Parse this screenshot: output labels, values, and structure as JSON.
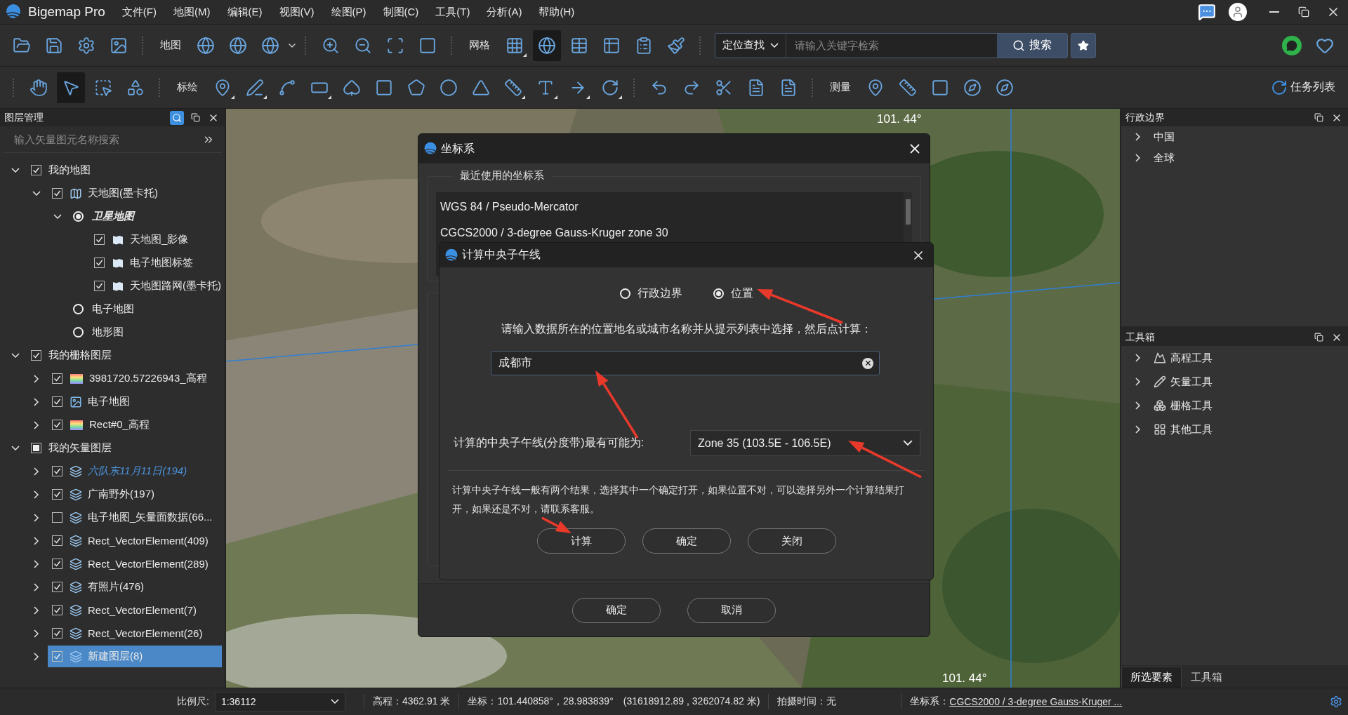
{
  "window": {
    "title": "Bigemap Pro"
  },
  "menu": [
    "文件(F)",
    "地图(M)",
    "编辑(E)",
    "视图(V)",
    "绘图(P)",
    "制图(C)",
    "工具(T)",
    "分析(A)",
    "帮助(H)"
  ],
  "toolbar_1": {
    "sections": [
      {
        "tools": [
          {
            "selected": false
          },
          {
            "selected": false
          },
          {
            "selected": false
          },
          {
            "selected": false
          }
        ]
      },
      {
        "label": "地图",
        "tools": [
          {
            "selected": false
          },
          {
            "selected": false
          },
          {
            "selected": false
          }
        ]
      },
      {
        "tools": [
          {
            "selected": false
          },
          {
            "selected": false
          },
          {
            "selected": false
          },
          {
            "selected": false
          }
        ]
      },
      {
        "label": "网格",
        "tools": [
          {
            "selected": false
          },
          {
            "selected": true
          },
          {
            "selected": false
          },
          {
            "selected": false
          },
          {
            "selected": false
          },
          {
            "selected": false
          }
        ]
      }
    ],
    "search": {
      "mode": "定位查找",
      "placeholder": "请输入关键字检索",
      "button": "搜索"
    }
  },
  "toolbar_2": {
    "sections": [
      {
        "tools": [
          {
            "selected": false
          },
          {
            "selected": true
          },
          {
            "selected": false
          },
          {
            "selected": false
          }
        ]
      },
      {
        "label": "标绘",
        "tools": [
          {
            "selected": false
          },
          {
            "selected": false
          },
          {
            "selected": false
          },
          {
            "selected": false
          },
          {
            "selected": false
          },
          {
            "selected": false
          },
          {
            "selected": false
          },
          {
            "selected": false
          },
          {
            "selected": false
          },
          {
            "selected": false
          },
          {
            "selected": false
          },
          {
            "selected": false
          },
          {
            "selected": false
          }
        ]
      },
      {
        "tools": [
          {
            "selected": false
          },
          {
            "selected": false
          },
          {
            "selected": false
          },
          {
            "selected": false
          },
          {
            "selected": false
          }
        ]
      },
      {
        "label": "测量",
        "tools": [
          {
            "selected": false
          },
          {
            "selected": false
          },
          {
            "selected": false
          },
          {
            "selected": false
          },
          {
            "selected": false
          }
        ]
      }
    ],
    "task_list": "任务列表"
  },
  "layer_panel": {
    "title": "图层管理",
    "search_placeholder": "输入矢量图元名称搜索",
    "tree": [
      {
        "kind": "checkbox",
        "label": "我的地图",
        "checked": true,
        "expanded": true,
        "selected": false,
        "children": [
          {
            "kind": "checkbox",
            "label": "天地图(墨卡托)",
            "checked": true,
            "expanded": true,
            "selected": false,
            "children": [
              {
                "kind": "radio",
                "label": "卫星地图",
                "checked": true,
                "expanded": true,
                "selected": false,
                "children": [
                  {
                    "kind": "checkbox",
                    "label": "天地图_影像",
                    "checked": true,
                    "selected": false
                  },
                  {
                    "kind": "checkbox",
                    "label": "电子地图标签",
                    "checked": true,
                    "selected": false
                  },
                  {
                    "kind": "checkbox",
                    "label": "天地图路网(墨卡托)",
                    "checked": true,
                    "selected": false
                  }
                ]
              },
              {
                "kind": "radio",
                "label": "电子地图",
                "checked": false,
                "selected": false
              },
              {
                "kind": "radio",
                "label": "地形图",
                "checked": false,
                "selected": false
              }
            ]
          }
        ]
      },
      {
        "kind": "checkbox",
        "label": "我的栅格图层",
        "checked": true,
        "expanded": true,
        "selected": false,
        "children": [
          {
            "kind": "checkbox",
            "label": "3981720.57226943_高程",
            "checked": true,
            "expanded": false,
            "selected": false
          },
          {
            "kind": "checkbox",
            "label": "电子地图",
            "checked": true,
            "expanded": false,
            "selected": false
          },
          {
            "kind": "checkbox",
            "label": "Rect#0_高程",
            "checked": true,
            "expanded": false,
            "selected": false
          }
        ]
      },
      {
        "kind": "checkbox",
        "label": "我的矢量图层",
        "checked": false,
        "indeterminate": true,
        "expanded": true,
        "selected": false,
        "children": [
          {
            "kind": "checkbox",
            "label": "六队东11月11日(194)",
            "checked": true,
            "expanded": false,
            "selected": false,
            "active": true
          },
          {
            "kind": "checkbox",
            "label": "广南野外(197)",
            "checked": true,
            "expanded": false,
            "selected": false,
            "active": false
          },
          {
            "kind": "checkbox",
            "label": "电子地图_矢量面数据(66...",
            "checked": false,
            "expanded": false,
            "selected": false,
            "active": false
          },
          {
            "kind": "checkbox",
            "label": "Rect_VectorElement(409)",
            "checked": true,
            "expanded": false,
            "selected": false,
            "active": false
          },
          {
            "kind": "checkbox",
            "label": "Rect_VectorElement(289)",
            "checked": true,
            "expanded": false,
            "selected": false,
            "active": false
          },
          {
            "kind": "checkbox",
            "label": "有照片(476)",
            "checked": true,
            "expanded": false,
            "selected": false,
            "active": false
          },
          {
            "kind": "checkbox",
            "label": "Rect_VectorElement(7)",
            "checked": true,
            "expanded": false,
            "selected": false,
            "active": false
          },
          {
            "kind": "checkbox",
            "label": "Rect_VectorElement(26)",
            "checked": true,
            "expanded": false,
            "selected": false,
            "active": false
          },
          {
            "kind": "checkbox",
            "label": "新建图层(8)",
            "checked": true,
            "expanded": false,
            "selected": true,
            "active": false
          }
        ]
      }
    ]
  },
  "map": {
    "labels": [
      "101. 44°",
      "101. 44°"
    ]
  },
  "coord_dialog": {
    "title": "坐标系",
    "group": "最近使用的坐标系",
    "recent": [
      "WGS 84 / Pseudo-Mercator",
      "CGCS2000 / 3-degree Gauss-Kruger zone 30"
    ],
    "buttons": [
      "确定",
      "取消"
    ]
  },
  "meridian_dialog": {
    "title": "计算中央子午线",
    "options": [
      {
        "label": "行政边界",
        "selected": false
      },
      {
        "label": "位置",
        "selected": true
      }
    ],
    "instruction": "请输入数据所在的位置地名或城市名称并从提示列表中选择，然后点计算：",
    "location": {
      "value": "成都市"
    },
    "zone_label": "计算的中央子午线(分度带)最有可能为:",
    "zone": {
      "value": "Zone 35 (103.5E - 106.5E)"
    },
    "note": "计算中央子午线一般有两个结果，选择其中一个确定打开，如果位置不对，可以选择另外一个计算结果打开，如果还是不对，请联系客服。",
    "buttons": [
      "计算",
      "确定",
      "关闭"
    ]
  },
  "admin_panel": {
    "title": "行政边界",
    "items": [
      {
        "label": "中国",
        "expanded": false
      },
      {
        "label": "全球",
        "expanded": false
      }
    ]
  },
  "toolbox_panel": {
    "title": "工具箱",
    "items": [
      {
        "label": "高程工具",
        "expanded": false
      },
      {
        "label": "矢量工具",
        "expanded": false
      },
      {
        "label": "栅格工具",
        "expanded": false
      },
      {
        "label": "其他工具",
        "expanded": false
      }
    ]
  },
  "panel_tabs": [
    {
      "label": "所选要素",
      "selected": true
    },
    {
      "label": "工具箱",
      "selected": false
    }
  ],
  "status_bar": {
    "scale_label": "比例尺:",
    "scale": "1:36112",
    "elevation": "高程：4362.91 米",
    "coords": "坐标：101.440858°，28.983839°",
    "projected": "(31618912.89 , 3262074.82 米)",
    "capture_time": "拍摄时间：无",
    "crs_label": "坐标系：",
    "crs": "CGCS2000 / 3-degree Gauss-Kruger ..."
  }
}
